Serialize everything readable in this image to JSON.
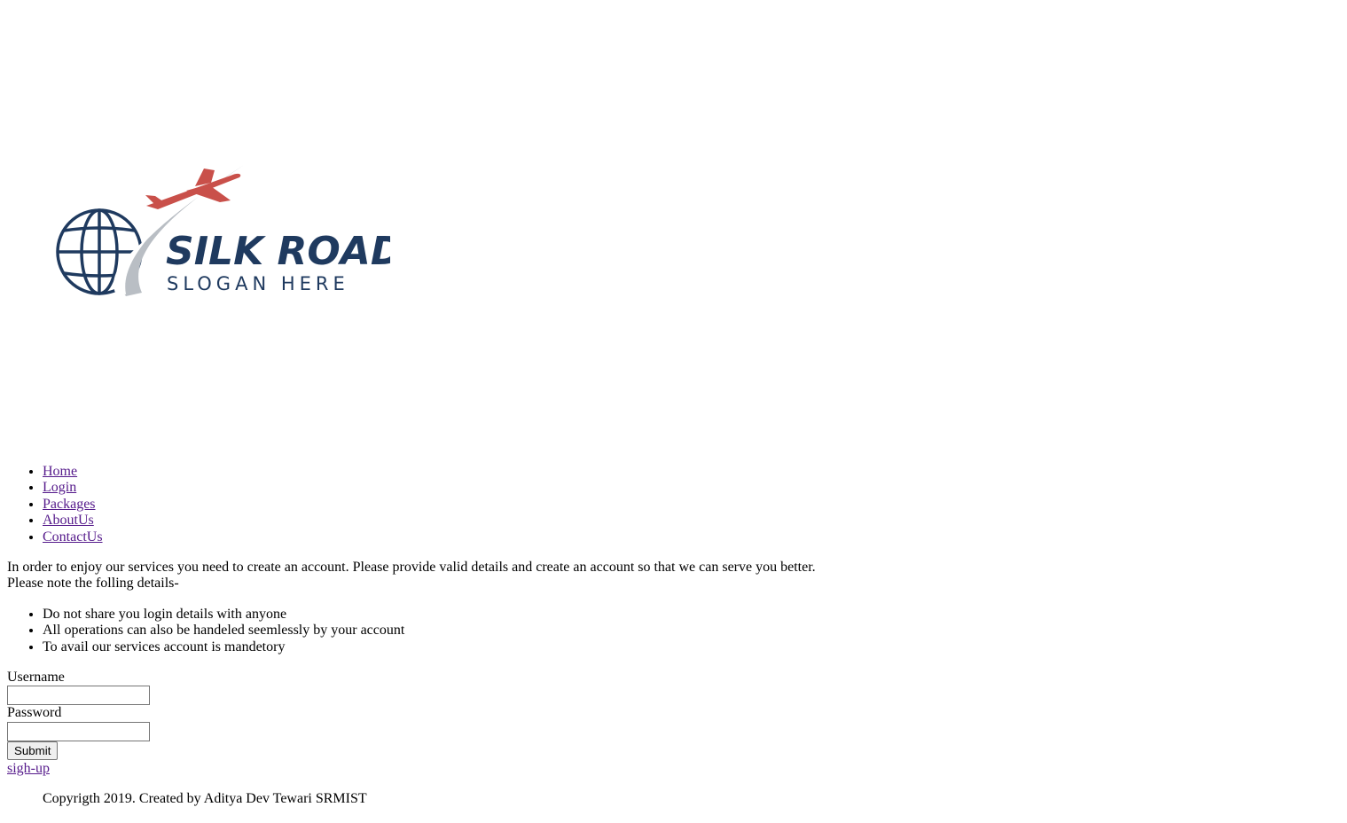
{
  "logo": {
    "brand": "SILK ROAD",
    "slogan": "SLOGAN HERE",
    "colors": {
      "navy": "#1f3a5f",
      "red": "#c9504a",
      "silver": "#b9bec4"
    },
    "icon": "globe-airplane-icon"
  },
  "nav": {
    "items": [
      {
        "label": "Home"
      },
      {
        "label": "Login"
      },
      {
        "label": "Packages"
      },
      {
        "label": "AboutUs"
      },
      {
        "label": "ContactUs"
      }
    ]
  },
  "intro": {
    "line1": "In order to enjoy our services you need to create an account. Please provide valid details and create an account so that we can serve you better.",
    "line2": "Please note the folling details-"
  },
  "notes": {
    "items": [
      {
        "text": "Do not share you login details with anyone"
      },
      {
        "text": "All operations can also be handeled seemlessly by your account"
      },
      {
        "text": "To avail our services account is mandetory"
      }
    ]
  },
  "form": {
    "username_label": "Username",
    "username_value": "",
    "password_label": "Password",
    "password_value": "",
    "submit_label": "Submit"
  },
  "signup_link": "sigh-up",
  "footer": {
    "text": "Copyrigth 2019. Created by Aditya Dev Tewari SRMIST"
  },
  "colors": {
    "link_visited": "#551a8b",
    "text": "#000000",
    "background": "#ffffff"
  }
}
